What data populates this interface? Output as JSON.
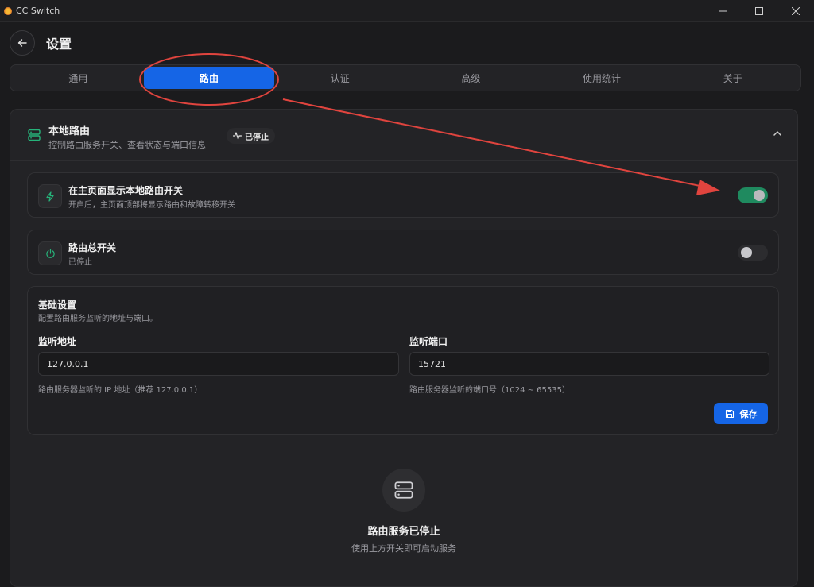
{
  "window": {
    "title": "CC Switch"
  },
  "header": {
    "title": "设置"
  },
  "tabs": [
    {
      "label": "通用",
      "active": false
    },
    {
      "label": "路由",
      "active": true
    },
    {
      "label": "认证",
      "active": false
    },
    {
      "label": "高级",
      "active": false
    },
    {
      "label": "使用统计",
      "active": false
    },
    {
      "label": "关于",
      "active": false
    }
  ],
  "local_router": {
    "title": "本地路由",
    "subtitle": "控制路由服务开关、查看状态与端口信息",
    "status": "已停止"
  },
  "show_toggle_card": {
    "title": "在主页面显示本地路由开关",
    "subtitle": "开启后，主页面顶部将显示路由和故障转移开关",
    "enabled": true
  },
  "master_switch_card": {
    "title": "路由总开关",
    "subtitle": "已停止",
    "enabled": false
  },
  "basic_settings": {
    "title": "基础设置",
    "subtitle": "配置路由服务监听的地址与端口。",
    "address_label": "监听地址",
    "address_value": "127.0.0.1",
    "address_hint": "路由服务器监听的 IP 地址（推荐 127.0.0.1）",
    "port_label": "监听端口",
    "port_value": "15721",
    "port_hint": "路由服务器监听的端口号（1024 ~ 65535）",
    "save_label": "保存"
  },
  "empty_state": {
    "title": "路由服务已停止",
    "subtitle": "使用上方开关即可启动服务"
  },
  "colors": {
    "accent": "#1565e6",
    "success": "#26b37a",
    "annotation": "#e0443e"
  }
}
